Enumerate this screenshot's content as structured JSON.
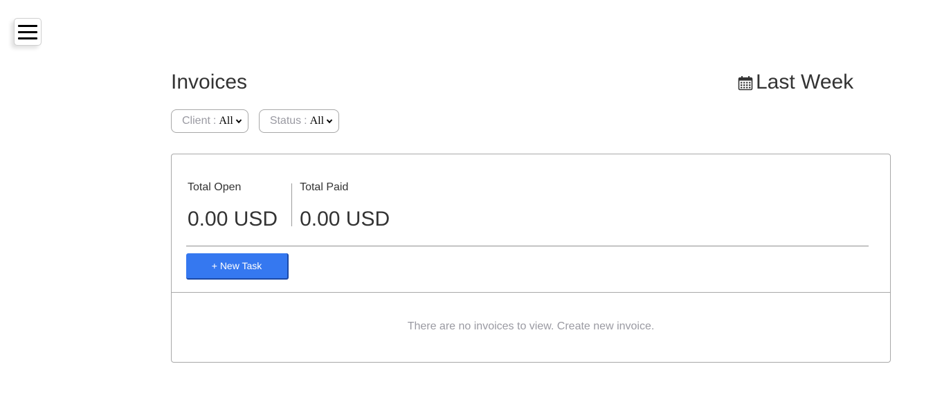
{
  "menu": {
    "icon": "hamburger-menu-icon"
  },
  "header": {
    "title": "Invoices",
    "date_range_icon": "calendar-icon",
    "date_range_label": "Last Week"
  },
  "filters": [
    {
      "label": "Client",
      "separator": ":",
      "value": "All"
    },
    {
      "label": "Status",
      "separator": ":",
      "value": "All"
    }
  ],
  "totals": {
    "open_label": "Total Open",
    "open_value": "0.00 USD",
    "paid_label": "Total Paid",
    "paid_value": "0.00 USD"
  },
  "actions": {
    "new_task_label": "+ New Task"
  },
  "colors": {
    "primary_button": "#3578f0",
    "muted_text": "#9a9aa2"
  },
  "empty_state": {
    "message": "There are no invoices to view. Create new invoice."
  }
}
